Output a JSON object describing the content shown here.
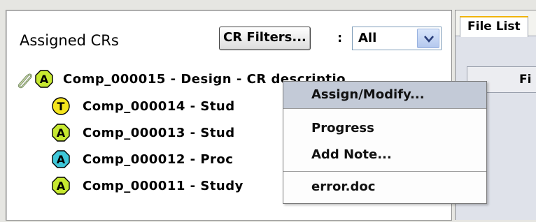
{
  "panel": {
    "title": "Assigned CRs",
    "filter_button_label": "CR Filters...",
    "filter_separator": ":",
    "filter_select_value": "All"
  },
  "cr_list": [
    {
      "badge_letter": "A",
      "badge_color": "#c6e830",
      "text": "Comp_000015 - Design - CR descriptio",
      "has_attachment": true
    },
    {
      "badge_letter": "T",
      "badge_color": "#f5e51e",
      "text": "Comp_000014 - Stud"
    },
    {
      "badge_letter": "A",
      "badge_color": "#c6e830",
      "text": "Comp_000013 - Stud"
    },
    {
      "badge_letter": "A",
      "badge_color": "#3fc7d9",
      "text": "Comp_000012 - Proc"
    },
    {
      "badge_letter": "A",
      "badge_color": "#c6e830",
      "text": "Comp_000011 - Study"
    }
  ],
  "context_menu": {
    "items": [
      {
        "label": "Assign/Modify...",
        "highlighted": true
      },
      {
        "label": "Progress"
      },
      {
        "label": "Add Note..."
      },
      {
        "label": "error.doc"
      }
    ]
  },
  "right_panel": {
    "tab_label": "File List",
    "header_label": "Fi"
  },
  "icons": {
    "attachment": "paperclip-icon",
    "dropdown": "chevron-down-icon"
  },
  "colors": {
    "menu_highlight": "#c3cad7",
    "tab_accent": "#f0b400"
  }
}
